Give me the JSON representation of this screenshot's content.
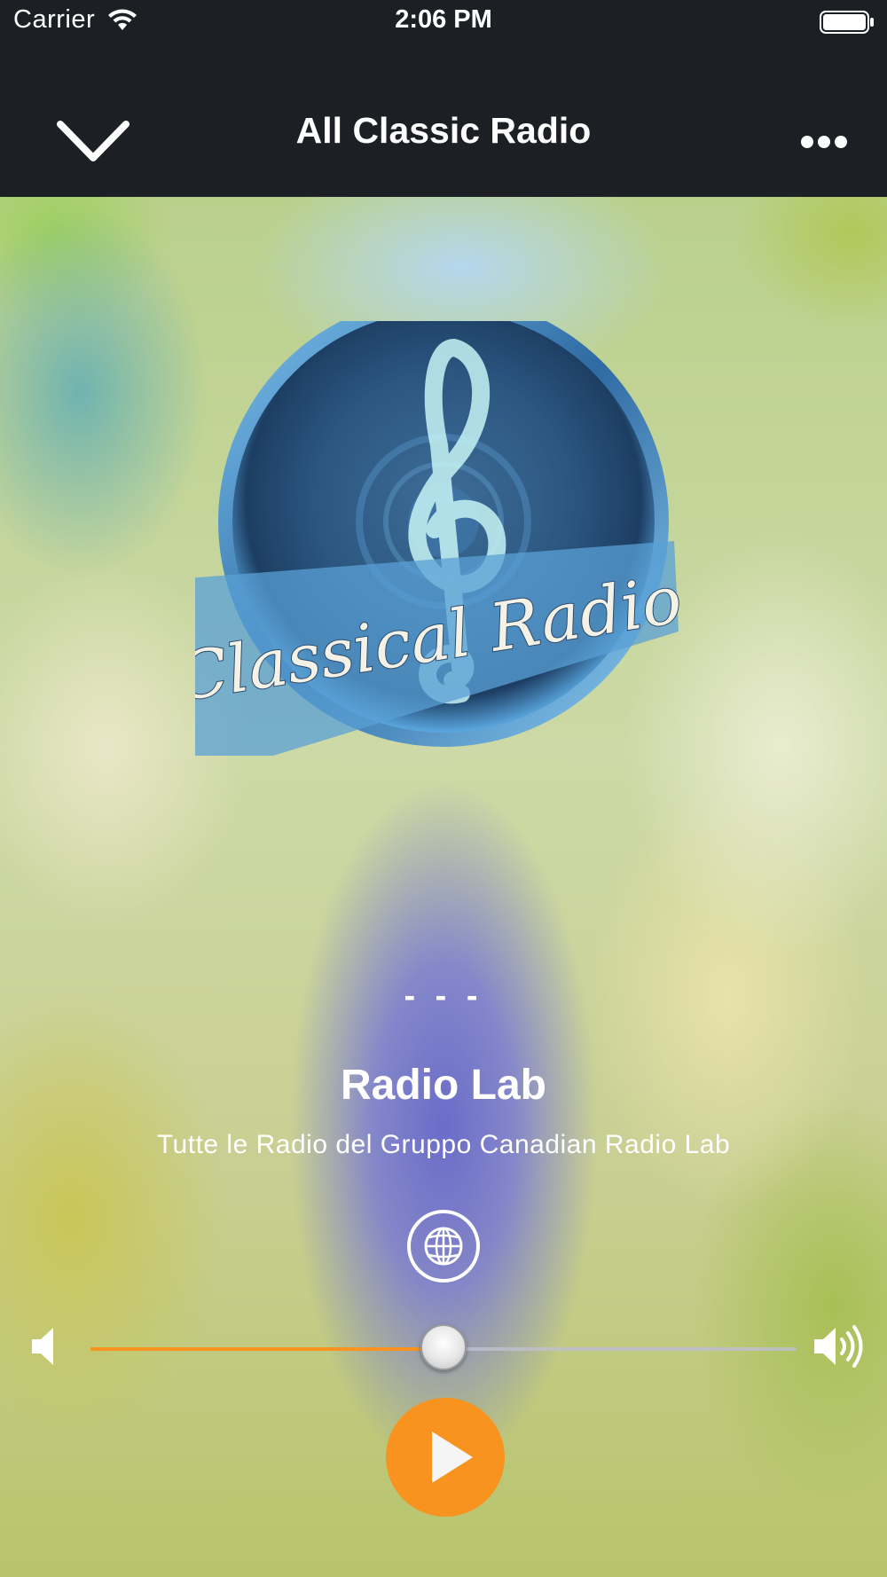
{
  "status_bar": {
    "carrier": "Carrier",
    "time": "2:06 PM"
  },
  "nav": {
    "title": "All Classic Radio",
    "back_icon": "chevron-down-icon",
    "more_icon": "ellipsis-icon"
  },
  "station": {
    "logo_text": "Classical Radio",
    "track_title": "- - -",
    "name": "Radio Lab",
    "description": "Tutte le Radio del Gruppo Canadian Radio Lab",
    "website_icon": "globe-icon"
  },
  "volume": {
    "level": 0.5,
    "low_icon": "volume-low-icon",
    "high_icon": "volume-high-icon"
  },
  "controls": {
    "play_icon": "play-icon"
  },
  "colors": {
    "bar_background": "#1c1f24",
    "accent": "#f7931e",
    "text": "#ffffff"
  }
}
